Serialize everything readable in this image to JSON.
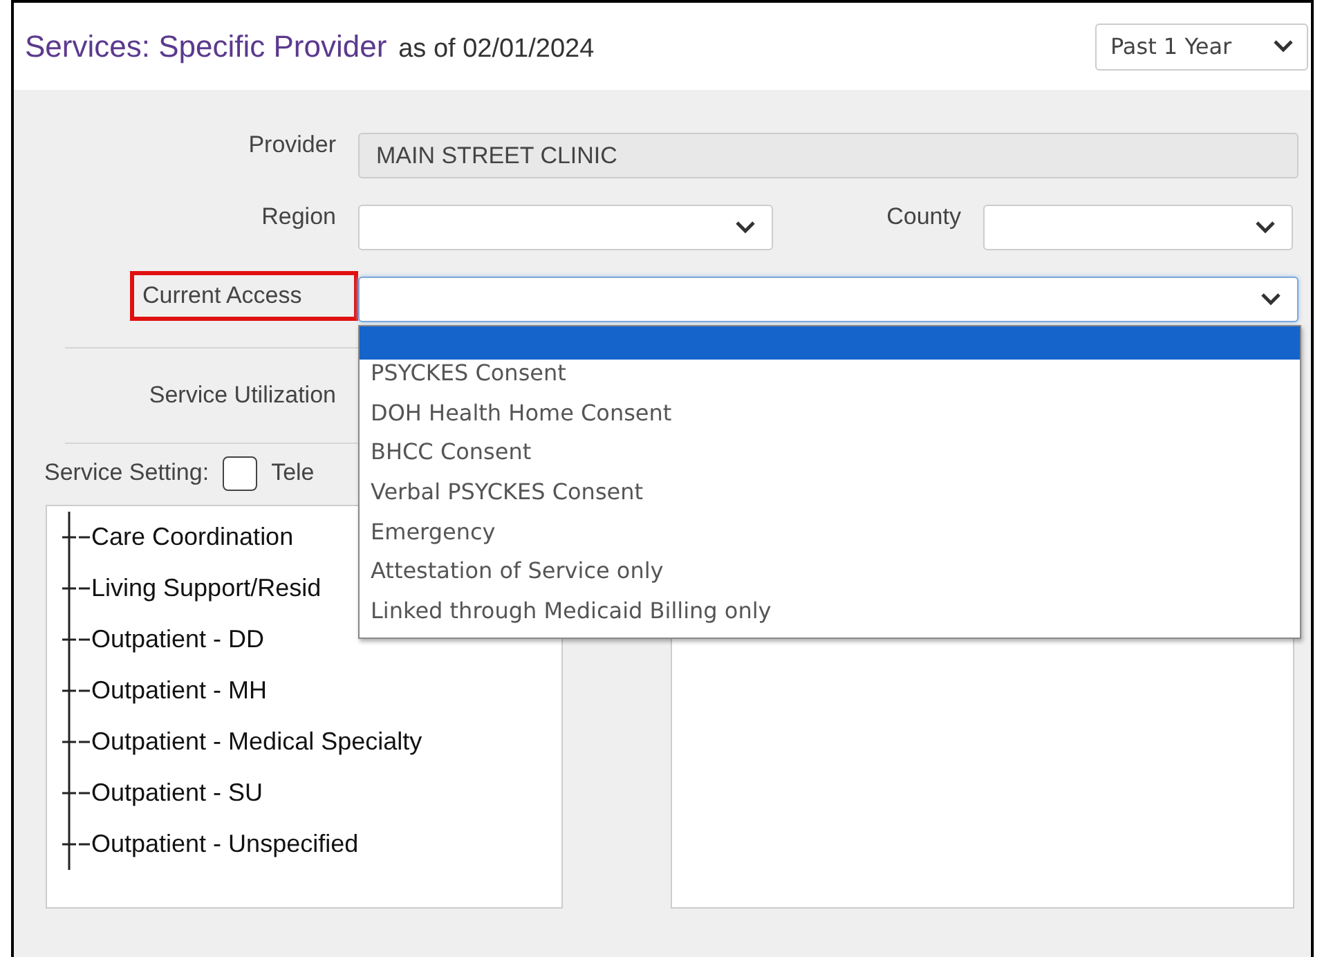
{
  "header": {
    "title": "Services: Specific Provider",
    "as_of": "as of 02/01/2024",
    "period": "Past 1 Year"
  },
  "form": {
    "provider_label": "Provider",
    "provider_value": "MAIN STREET CLINIC",
    "region_label": "Region",
    "county_label": "County",
    "access_label": "Current Access",
    "access_highlighted": true,
    "utilization_label": "Service Utilization"
  },
  "access_options": [
    {
      "selected": true
    },
    {
      "label": "PSYCKES Consent",
      "selected": false
    },
    {
      "label": "DOH Health Home Consent",
      "selected": false
    },
    {
      "label": "BHCC Consent",
      "selected": false
    },
    {
      "label": "Verbal PSYCKES Consent",
      "selected": false
    },
    {
      "label": "Emergency",
      "selected": false
    },
    {
      "label": "Attestation of Service only",
      "selected": false
    },
    {
      "label": "Linked through Medicaid Billing only",
      "selected": false
    }
  ],
  "service_setting": {
    "label": "Service Setting:",
    "checkbox_label": "Tele",
    "checked": false
  },
  "settings_tree": [
    {
      "label": "Care Coordination"
    },
    {
      "label": "Living Support/Resid"
    },
    {
      "label": "Outpatient - DD"
    },
    {
      "label": "Outpatient - MH"
    },
    {
      "label": "Outpatient - Medical Specialty"
    },
    {
      "label": "Outpatient - SU"
    },
    {
      "label": "Outpatient - Unspecified"
    }
  ]
}
